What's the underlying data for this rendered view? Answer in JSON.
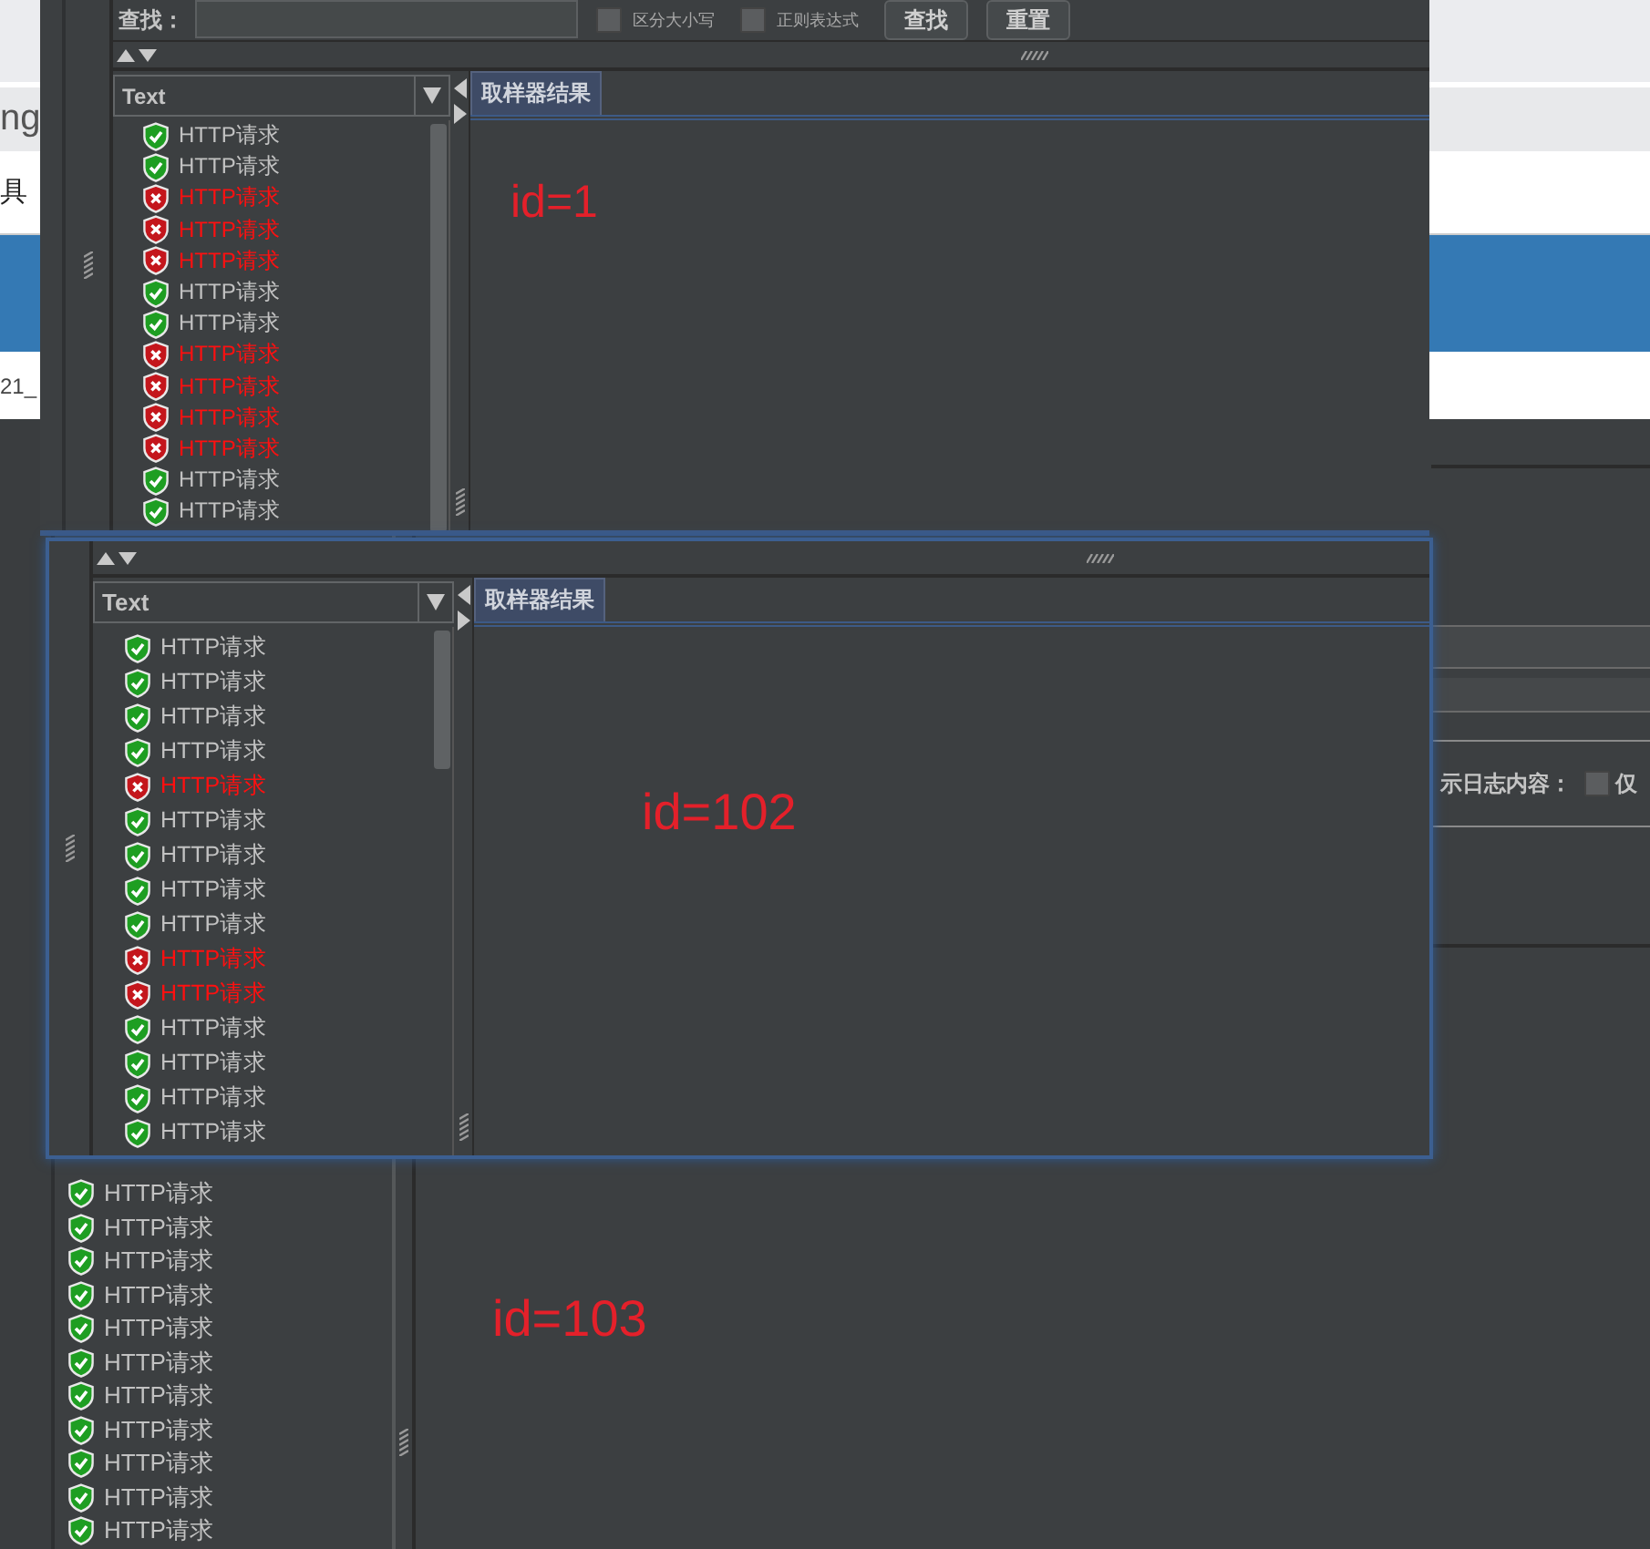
{
  "browser_page": {
    "fragments": [
      {
        "text": "ng",
        "kind": "heading"
      },
      {
        "text": "具",
        "kind": "body"
      },
      {
        "text": "21_",
        "kind": "muted"
      }
    ]
  },
  "results_windows": [
    {
      "annotation": "id=1",
      "search": {
        "label": "查找：",
        "options": [
          {
            "label": "区分大小写",
            "checked": false
          },
          {
            "label": "正则表达式",
            "checked": false
          }
        ],
        "buttons": [
          "查找",
          "重置"
        ]
      },
      "renderer": "Text",
      "tabs": [
        {
          "label": "取样器结果",
          "selected": true
        }
      ],
      "samples": [
        {
          "label": "HTTP请求",
          "failed": false
        },
        {
          "label": "HTTP请求",
          "failed": false
        },
        {
          "label": "HTTP请求",
          "failed": true
        },
        {
          "label": "HTTP请求",
          "failed": true
        },
        {
          "label": "HTTP请求",
          "failed": true
        },
        {
          "label": "HTTP请求",
          "failed": false
        },
        {
          "label": "HTTP请求",
          "failed": false
        },
        {
          "label": "HTTP请求",
          "failed": true
        },
        {
          "label": "HTTP请求",
          "failed": true
        },
        {
          "label": "HTTP请求",
          "failed": true
        },
        {
          "label": "HTTP请求",
          "failed": true
        },
        {
          "label": "HTTP请求",
          "failed": false
        },
        {
          "label": "HTTP请求",
          "failed": false
        }
      ]
    },
    {
      "annotation": "id=102",
      "renderer": "Text",
      "tabs": [
        {
          "label": "取样器结果",
          "selected": true
        }
      ],
      "samples": [
        {
          "label": "HTTP请求",
          "failed": false
        },
        {
          "label": "HTTP请求",
          "failed": false
        },
        {
          "label": "HTTP请求",
          "failed": false
        },
        {
          "label": "HTTP请求",
          "failed": false
        },
        {
          "label": "HTTP请求",
          "failed": true
        },
        {
          "label": "HTTP请求",
          "failed": false
        },
        {
          "label": "HTTP请求",
          "failed": false
        },
        {
          "label": "HTTP请求",
          "failed": false
        },
        {
          "label": "HTTP请求",
          "failed": false
        },
        {
          "label": "HTTP请求",
          "failed": true
        },
        {
          "label": "HTTP请求",
          "failed": true
        },
        {
          "label": "HTTP请求",
          "failed": false
        },
        {
          "label": "HTTP请求",
          "failed": false
        },
        {
          "label": "HTTP请求",
          "failed": false
        },
        {
          "label": "HTTP请求",
          "failed": false
        }
      ]
    }
  ],
  "background_window": {
    "annotation": "id=103",
    "log_label": "示日志内容：",
    "log_option": {
      "label": "仅",
      "checked": false
    },
    "samples": [
      {
        "label": "HTTP请求",
        "failed": false
      },
      {
        "label": "HTTP请求",
        "failed": false
      },
      {
        "label": "HTTP请求",
        "failed": false
      },
      {
        "label": "HTTP请求",
        "failed": false
      },
      {
        "label": "HTTP请求",
        "failed": false
      },
      {
        "label": "HTTP请求",
        "failed": false
      },
      {
        "label": "HTTP请求",
        "failed": false
      },
      {
        "label": "HTTP请求",
        "failed": false
      },
      {
        "label": "HTTP请求",
        "failed": false
      },
      {
        "label": "HTTP请求",
        "failed": false
      },
      {
        "label": "HTTP请求",
        "failed": false
      }
    ]
  }
}
